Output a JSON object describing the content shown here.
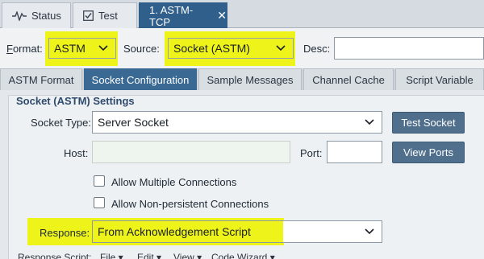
{
  "tabs": [
    {
      "label": "Status",
      "icon": "pulse-icon"
    },
    {
      "label": "Test",
      "icon": "checkbox-icon"
    },
    {
      "label": "1. ASTM-TCP",
      "icon": "close-icon",
      "active": true
    }
  ],
  "format_row": {
    "format_label_prefix": "F",
    "format_label_rest": "ormat:",
    "format_value": "ASTM",
    "source_label": "Source:",
    "source_value": "Socket (ASTM)",
    "desc_label": "Desc:",
    "desc_value": ""
  },
  "subtabs": [
    {
      "label": "ASTM Format"
    },
    {
      "label": "Socket Configuration",
      "active": true
    },
    {
      "label": "Sample Messages"
    },
    {
      "label": "Channel Cache"
    },
    {
      "label": "Script Variable"
    }
  ],
  "settings": {
    "title": "Socket (ASTM) Settings",
    "socket_type_label": "Socket Type:",
    "socket_type_value": "Server Socket",
    "test_socket_label": "Test Socket",
    "host_label": "Host:",
    "host_value": "",
    "port_label": "Port:",
    "port_value": "",
    "view_ports_label": "View Ports",
    "allow_multiple_label": "Allow Multiple Connections",
    "allow_non_persistent_label": "Allow Non-persistent Connections",
    "response_label": "Response:",
    "response_value": "From Acknowledgement Script"
  },
  "bottom_row": {
    "label": "Response Script:",
    "menus": [
      "File ▾",
      "Edit ▾",
      "View ▾",
      "Code Wizard ▾"
    ]
  },
  "colors": {
    "highlight": "#eef41a",
    "active_tab": "#2f5f8a",
    "button": "#4f6f8c"
  }
}
